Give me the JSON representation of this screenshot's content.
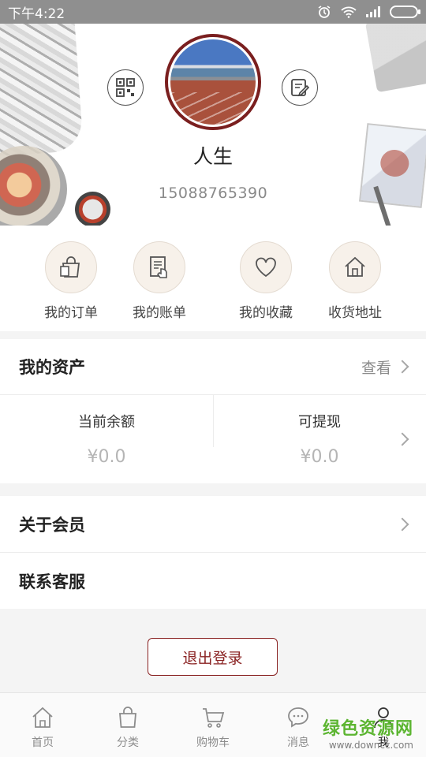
{
  "status_bar": {
    "time": "下午4:22",
    "icons": [
      "alarm-icon",
      "wifi-icon",
      "signal-icon",
      "battery-icon"
    ]
  },
  "profile": {
    "name": "人生",
    "phone": "15088765390"
  },
  "shortcuts": [
    {
      "label": "我的订单",
      "icon": "shopping-bag-icon"
    },
    {
      "label": "我的账单",
      "icon": "bill-icon"
    },
    {
      "label": "我的收藏",
      "icon": "heart-icon"
    },
    {
      "label": "收货地址",
      "icon": "home-icon"
    }
  ],
  "assets": {
    "title": "我的资产",
    "view_label": "查看",
    "balance_label": "当前余额",
    "balance_value": "¥0.0",
    "withdraw_label": "可提现",
    "withdraw_value": "¥0.0"
  },
  "menu": {
    "membership": "关于会员",
    "service": "联系客服"
  },
  "logout_label": "退出登录",
  "tabs": [
    {
      "label": "首页",
      "icon": "home-icon"
    },
    {
      "label": "分类",
      "icon": "bag-icon"
    },
    {
      "label": "购物车",
      "icon": "cart-icon"
    },
    {
      "label": "消息",
      "icon": "chat-icon"
    },
    {
      "label": "我",
      "icon": "user-icon",
      "active": true
    }
  ],
  "watermark": {
    "text": "绿色资源网",
    "url": "www.downcc.com"
  },
  "colors": {
    "accent": "#8a2323",
    "text": "#222222",
    "muted": "#8a8a8a"
  }
}
